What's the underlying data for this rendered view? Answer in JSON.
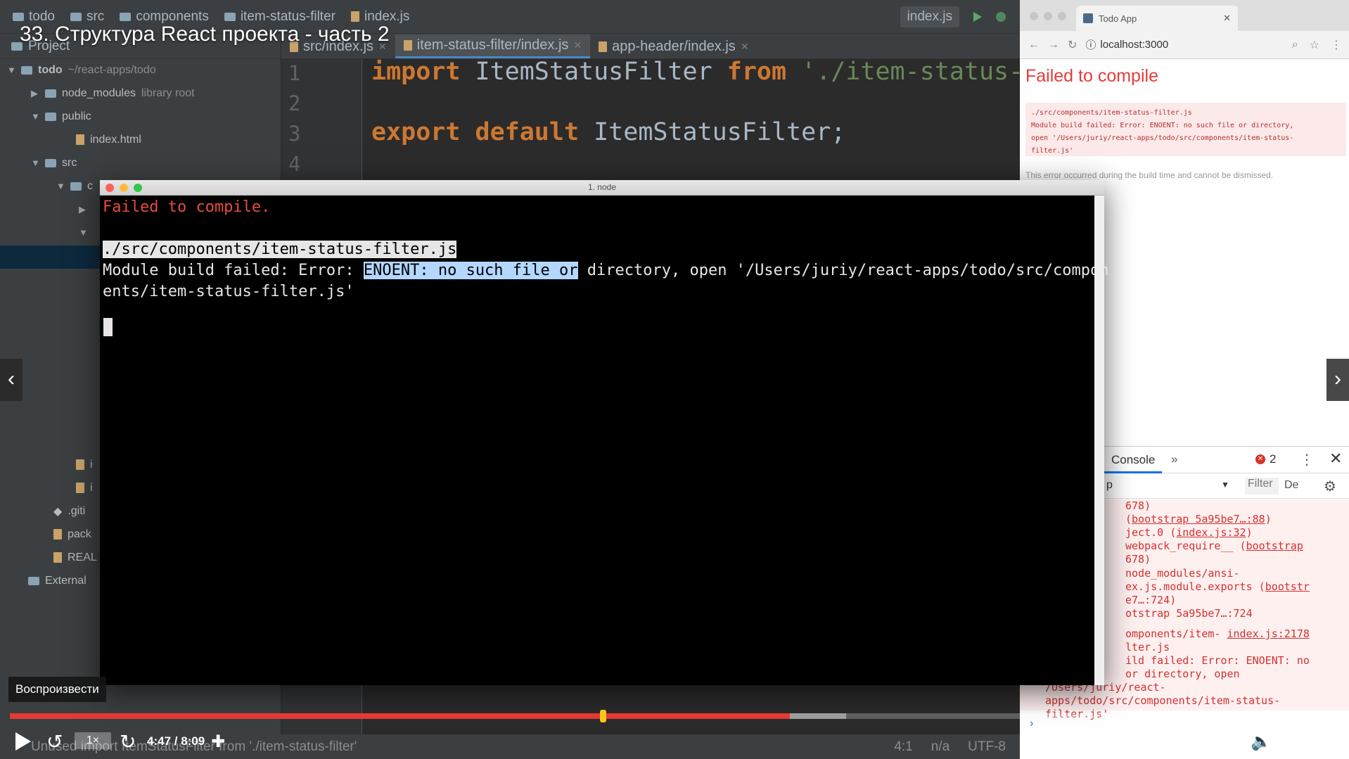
{
  "video": {
    "title": "33. Структура React проекта - часть 2",
    "tooltip": "Воспроизвести",
    "speed": "1×",
    "time": "4:47 / 8:09",
    "progress_fraction": 0.587,
    "buffered_fraction": 0.629
  },
  "ide": {
    "breadcrumbs": [
      "todo",
      "src",
      "components",
      "item-status-filter",
      "index.js"
    ],
    "run_config": "index.js",
    "tabs": [
      {
        "label": "src/index.js",
        "active": false
      },
      {
        "label": "item-status-filter/index.js",
        "active": true
      },
      {
        "label": "app-header/index.js",
        "active": false
      }
    ],
    "project_header": "Project",
    "tree": {
      "root": "todo",
      "root_path": "~/react-apps/todo",
      "node_modules": "node_modules",
      "node_modules_note": "library root",
      "public": "public",
      "index_html": "index.html",
      "src": "src",
      "c_folder": "c",
      "file_i1": "i",
      "file_i2": "i",
      "gitignore": ".giti",
      "package": "pack",
      "readme": "REAL",
      "external": "External"
    },
    "line_numbers": [
      "1",
      "2",
      "3",
      "4"
    ],
    "code": {
      "l1_kw1": "import",
      "l1_id": "ItemStatusFilter",
      "l1_kw2": "from",
      "l1_str": "'./item-status-",
      "l3_kw1": "export",
      "l3_kw2": "default",
      "l3_id": "ItemStatusFilter;"
    },
    "status": {
      "message": "Unused import ItemStatusFilter from './item-status-filter'",
      "position": "4:1",
      "na": "n/a",
      "encoding": "UTF-8"
    }
  },
  "terminal": {
    "title": "1. node",
    "fail": "Failed to compile.",
    "path": "./src/components/item-status-filter.js",
    "line2_prefix": "Module build failed: Error: ",
    "line2_selected": "ENOENT: no such file or",
    "line2_suffix": " directory, open '/Users/juriy/react-apps/todo/src/compon",
    "line3": "ents/item-status-filter.js'"
  },
  "browser": {
    "tab_title": "Todo App",
    "url": "localhost:3000",
    "error_title": "Failed to compile",
    "error_text": "./src/components/item-status-filter.js\nModule build failed: Error: ENOENT: no such file or directory,\nopen '/Users/juriy/react-apps/todo/src/components/item-status-\nfilter.js'",
    "error_note": "This error occurred during the build time and cannot be dismissed.",
    "devtools": {
      "console_tab": "Console",
      "more": "»",
      "error_count": "2",
      "context": "p",
      "filter_placeholder": "Filter",
      "levels": "De",
      "log": {
        "l0": "678)",
        "l1_pre": " (",
        "l1_link": "bootstrap 5a95be7…:88",
        "l1_post": ")",
        "l2_pre": "ject.0 (",
        "l2_link": "index.js:32",
        "l2_post": ")",
        "l3_pre": "webpack_require__ (",
        "l3_link": "bootstrap",
        "l4": "678)",
        "l5": "node_modules/ansi-",
        "l6_pre": "ex.js.module.exports (",
        "l6_link": "bootstr",
        "l7": "e7…:724)",
        "l8": "otstrap 5a95be7…:724",
        "l9_pre": "omponents/item-  ",
        "l9_link": "index.js:2178",
        "l10": "lter.js",
        "l11": "ild failed: Error: ENOENT: no",
        "l12": " or directory, open",
        "l13": "/Users/juriy/react-",
        "l14": "apps/todo/src/components/item-status-",
        "l15": "filter.js'"
      }
    }
  }
}
